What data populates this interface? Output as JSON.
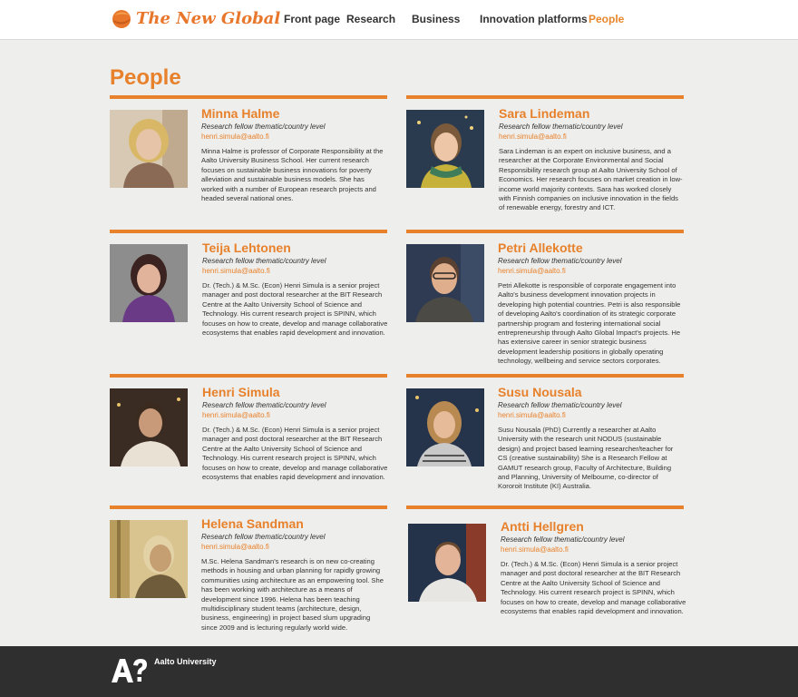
{
  "header": {
    "logo_text": "The New Global",
    "nav": [
      {
        "label": "Front page"
      },
      {
        "label": "Research"
      },
      {
        "label": "Business"
      },
      {
        "label": "Innovation platforms"
      },
      {
        "label": "People"
      }
    ]
  },
  "page": {
    "title": "People"
  },
  "people": [
    {
      "name": "Minna Halme",
      "role": "Research fellow thematic/country level",
      "email": "henri.simula@aalto.fi",
      "bio": "Minna Halme is professor of Corporate Responsibility at the Aalto University Business School. Her current research focuses on sustainable business innovations for poverty alleviation and sustainable business models. She has worked with a number of European research projects and headed several national ones."
    },
    {
      "name": "Sara Lindeman",
      "role": "Research fellow thematic/country level",
      "email": "henri.simula@aalto.fi",
      "bio": "Sara Lindeman is an expert on inclusive business, and a researcher at the Corporate Environmental and Social Responsibility research group at Aalto University School of Economics. Her research focuses on market creation in low-income world majority contexts. Sara has worked closely with Finnish companies on inclusive innovation in the fields of renewable energy, forestry and ICT."
    },
    {
      "name": "Teija Lehtonen",
      "role": "Research fellow thematic/country level",
      "email": "henri.simula@aalto.fi",
      "bio": "Dr. (Tech.) & M.Sc. (Econ) Henri Simula is a senior project manager and post doctoral researcher at the BIT Research Centre at the Aalto University School of Science and Technology.  His current research project is SPINN, which focuses on how to create, develop and manage collaborative ecosystems that enables rapid development and innovation."
    },
    {
      "name": "Petri Allekotte",
      "role": "Research fellow thematic/country level",
      "email": "henri.simula@aalto.fi",
      "bio": "Petri Allekotte is responsible of corporate engagement into Aalto's business development innovation projects in developing high potential countries. Petri is also responsible of developing Aalto's coordination of its strategic corporate partnership program and fostering international social entrepreneurship through Aalto Global Impact's projects. He has extensive career in senior strategic business development leadership positions in globally operating technology, wellbeing and service sectors corporates."
    },
    {
      "name": "Henri Simula",
      "role": "Research fellow thematic/country level",
      "email": "henri.simula@aalto.fi",
      "bio": "Dr. (Tech.) & M.Sc. (Econ) Henri Simula is a senior project manager and post doctoral researcher at the BIT Research Centre at the Aalto University School of Science and Technology.  His current research project is SPINN, which focuses on how to create, develop and manage collaborative ecosystems that enables rapid development and innovation."
    },
    {
      "name": "Susu Nousala",
      "role": "Research fellow thematic/country level",
      "email": "henri.simula@aalto.fi",
      "bio": "Susu Nousala (PhD) Currently a researcher at Aalto University with the research unit NODUS (sustainable design) and project based learning researcher/teacher for CS (creative sustainability) She is a Research Fellow at GAMUT research group, Faculty of Architecture, Building and Planning, University of Melbourne, co-director of Kororoit Institute (KI) Australia."
    },
    {
      "name": "Helena Sandman",
      "role": "Research fellow thematic/country level",
      "email": "henri.simula@aalto.fi",
      "bio": "M.Sc. Helena Sandman's research is on new co-creating methods in housing and urban planning for rapidly growing communities using architecture as an empowering tool. She has been working with architecture as a means of development since 1996. Helena has been teaching multidisciplinary student teams (architecture, design, business, engineering) in project based slum upgrading since 2009 and is lecturing regularly world wide."
    },
    {
      "name": "Antti Hellgren",
      "role": "Research fellow thematic/country level",
      "email": "henri.simula@aalto.fi",
      "bio": "Dr. (Tech.) & M.Sc. (Econ) Henri Simula is a senior project manager and post doctoral researcher at the BIT Research Centre at the Aalto University School of Science and Technology.  His current research project is SPINN, which focuses on how to create, develop and manage collaborative ecosystems that enables rapid development and innovation."
    }
  ],
  "footer": {
    "logo_text": "A?",
    "university": "Aalto University"
  },
  "colors": {
    "accent": "#e8812b",
    "footer_bg": "#2f2f2f",
    "page_bg": "#eeeeec"
  }
}
